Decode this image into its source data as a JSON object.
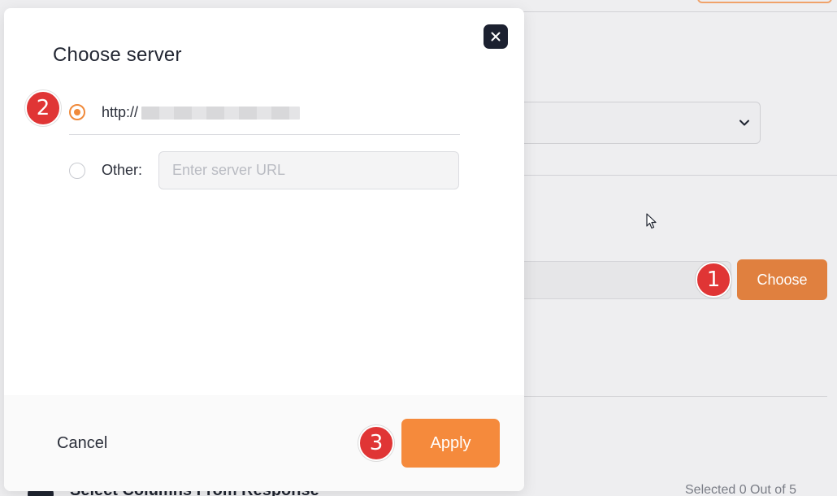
{
  "modal": {
    "title": "Choose server",
    "options": [
      {
        "label": "http://",
        "selected": true
      },
      {
        "label": "Other:",
        "selected": false
      }
    ],
    "url_placeholder": "Enter server URL",
    "cancel_label": "Cancel",
    "apply_label": "Apply"
  },
  "background": {
    "choose_label": "Choose",
    "section_title": "Select Columns From Response",
    "selected_count": "Selected 0 Out of 5"
  },
  "steps": [
    "1",
    "2",
    "3"
  ],
  "colors": {
    "accent": "#f58a3c",
    "choose_button": "#e0803f",
    "step_badge": "#e03535",
    "close_button": "#1c2130"
  },
  "icons": [
    "close-icon",
    "chevron-down-icon",
    "mouse-cursor-icon",
    "section-icon"
  ]
}
